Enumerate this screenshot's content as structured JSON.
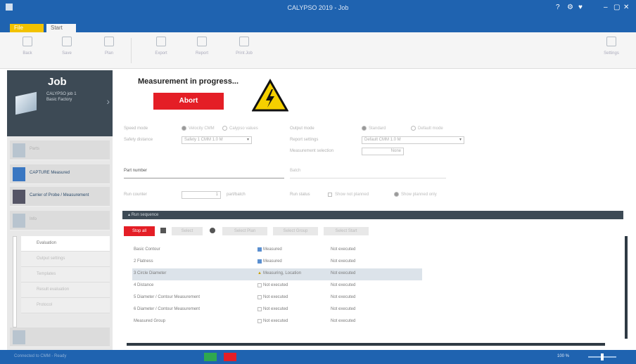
{
  "titlebar": {
    "title": "CALYPSO 2019 - Job"
  },
  "tabs": [
    {
      "label": "File"
    },
    {
      "label": "Start"
    }
  ],
  "ribbon": {
    "buttons": [
      {
        "label": "Back",
        "icon": "back-icon"
      },
      {
        "label": "Save",
        "icon": "save-icon"
      },
      {
        "label": "Plan",
        "icon": "plan-icon"
      },
      {
        "label": "Export",
        "icon": "export-icon"
      },
      {
        "label": "Report",
        "icon": "report-icon"
      },
      {
        "label": "Print Job",
        "icon": "print-icon"
      },
      {
        "label": "Settings",
        "icon": "settings-icon"
      }
    ]
  },
  "job": {
    "title": "Job",
    "subtitle_1": "CALYPSO job 1",
    "subtitle_2": "Basic Factory"
  },
  "nav": {
    "items": [
      {
        "label": "Parts"
      },
      {
        "label": "CAPTURE Measured"
      },
      {
        "label": "Carrier of Probe / Measurement"
      },
      {
        "label": "Info"
      }
    ],
    "subitems": [
      {
        "label": "Evaluation"
      },
      {
        "label": "Output settings"
      },
      {
        "label": "Templates"
      },
      {
        "label": "Result evaluation"
      },
      {
        "label": "Protocol"
      }
    ]
  },
  "main": {
    "status": "Measurement in progress...",
    "abort_label": "Abort",
    "form": {
      "speed_label": "Speed mode",
      "speed_opt1": "Velocity CMM",
      "speed_opt2": "Calypso values",
      "safety_label": "Safety distance",
      "safety_value": "Safety 1 CMM 1.0 M",
      "output_label": "Output mode",
      "output_opt1": "Standard",
      "output_opt2": "Default mode",
      "report_label": "Report settings",
      "report_value": "Default CMM 1.0 M",
      "measurement_label": "Measurement selection",
      "measurement_value": "None",
      "part_number_label": "Part number",
      "part_number_value": "Part number",
      "batch_label": "Batch",
      "run_label": "Run counter",
      "run_value": "1",
      "run_unit": "part/batch",
      "run_label2": "Run status",
      "check1": "Show not planned",
      "check2": "Show planned only"
    },
    "section_title": "Run sequence",
    "toolbar": {
      "stop_label": "Stop all",
      "btn1": "Select",
      "btn2": "Select Plan",
      "btn3": "Select Group",
      "btn4": "Select Start"
    },
    "table": [
      {
        "name": "Basic Contour",
        "status": "Measured",
        "result": "Not executed",
        "checked": true
      },
      {
        "name": "2 Flatness",
        "status": "Measured",
        "result": "Not executed",
        "checked": true
      },
      {
        "name": "3 Circle Diameter",
        "status": "Measuring, Location",
        "result": "Not executed",
        "checked": false,
        "selected": true
      },
      {
        "name": "4 Distance",
        "status": "Not executed",
        "result": "Not executed",
        "checked": false
      },
      {
        "name": "5 Diameter / Contour Measurement",
        "status": "Not executed",
        "result": "Not executed",
        "checked": false
      },
      {
        "name": "6 Diameter / Contour Measurement",
        "status": "Not executed",
        "result": "Not executed",
        "checked": false
      },
      {
        "name": "Measured Group",
        "status": "Not executed",
        "result": "Not executed",
        "checked": false
      }
    ]
  },
  "statusbar": {
    "left_text": "Connected to CMM - Ready",
    "zoom_text": "100 %"
  }
}
